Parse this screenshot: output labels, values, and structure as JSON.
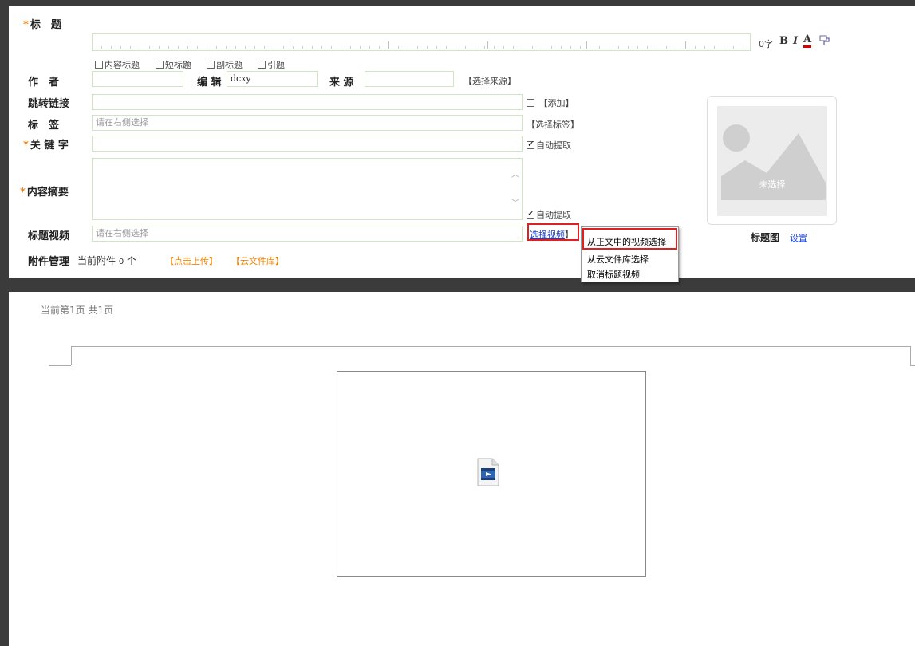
{
  "form": {
    "title_label": "标　题",
    "char_count": "0字",
    "fmt_bold": "B",
    "fmt_italic": "I",
    "fmt_color": "A",
    "title_options": [
      "内容标题",
      "短标题",
      "副标题",
      "引题"
    ],
    "author_label": "作　者",
    "editor_label": "编 辑",
    "editor_value": "dcxy",
    "source_label": "来 源",
    "select_source": "【选择来源】",
    "redirect_label": "跳转链接",
    "add_label": "【添加】",
    "tags_label": "标　签",
    "tags_placeholder": "请在右侧选择",
    "select_tags": "【选择标签】",
    "keywords_label": "关 键 字",
    "auto_extract": "自动提取",
    "summary_label": "内容摘要",
    "summary_auto_extract": "自动提取",
    "video_label": "标题视频",
    "video_placeholder": "请在右侧选择",
    "select_video": "选择视频",
    "select_video_bracket": "】",
    "attach_label": "附件管理",
    "attach_current": "当前附件",
    "attach_count": "0",
    "attach_unit": "个",
    "upload_link": "【点击上传】",
    "cloud_link": "【云文件库】"
  },
  "title_image": {
    "placeholder": "未选择",
    "label": "标题图",
    "set_link": "设置"
  },
  "video_menu": {
    "items": [
      "从正文中的视频选择",
      "从云文件库选择",
      "取消标题视频"
    ]
  },
  "editor": {
    "page_info": "当前第1页  共1页"
  },
  "colors": {
    "required_star": "#e8821e",
    "highlight": "#e02020",
    "link": "#1a3fcc",
    "orange_link": "#f08300",
    "input_border": "#cfe6c2"
  }
}
